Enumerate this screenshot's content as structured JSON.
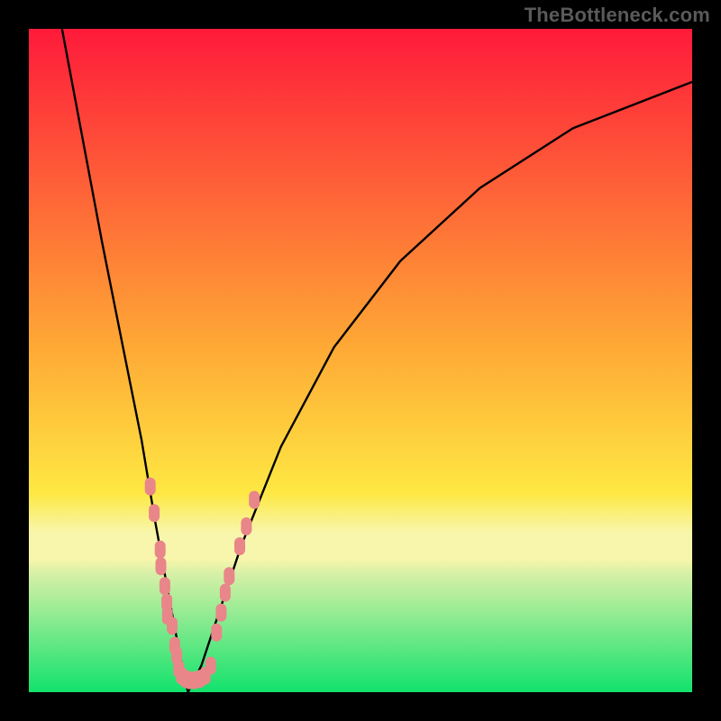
{
  "watermark": "TheBottleneck.com",
  "colors": {
    "frame": "#000000",
    "curve": "#000000",
    "scatter": "#e98689",
    "gradient_top": "#fe1a3a",
    "gradient_mid": "#fee843",
    "gradient_band_top": "#f7f6ac",
    "gradient_band_bot": "#d8f0a7",
    "gradient_bottom": "#12e26c"
  },
  "chart_data": {
    "type": "line",
    "title": "",
    "xlabel": "",
    "ylabel": "",
    "xlim": [
      0,
      100
    ],
    "ylim": [
      0,
      100
    ],
    "notch_x": 24,
    "left_curve": {
      "x": [
        5,
        8,
        11,
        14,
        17,
        19,
        21,
        22.5,
        23.5,
        24
      ],
      "values": [
        100,
        84,
        68,
        53,
        38,
        26,
        15,
        7,
        2,
        0
      ]
    },
    "right_curve": {
      "x": [
        24,
        26,
        28,
        32,
        38,
        46,
        56,
        68,
        82,
        100
      ],
      "values": [
        0,
        4,
        10,
        22,
        37,
        52,
        65,
        76,
        85,
        92
      ]
    },
    "scatter_points": [
      {
        "x": 18.3,
        "y": 31
      },
      {
        "x": 18.9,
        "y": 27
      },
      {
        "x": 19.8,
        "y": 21.5
      },
      {
        "x": 19.9,
        "y": 19
      },
      {
        "x": 20.5,
        "y": 16
      },
      {
        "x": 20.8,
        "y": 13.5
      },
      {
        "x": 20.9,
        "y": 11.5
      },
      {
        "x": 21.6,
        "y": 10
      },
      {
        "x": 22.0,
        "y": 7
      },
      {
        "x": 22.3,
        "y": 5.5
      },
      {
        "x": 22.6,
        "y": 3.5
      },
      {
        "x": 23.0,
        "y": 2.5
      },
      {
        "x": 23.6,
        "y": 2
      },
      {
        "x": 24.2,
        "y": 1.8
      },
      {
        "x": 25.0,
        "y": 1.8
      },
      {
        "x": 25.8,
        "y": 2
      },
      {
        "x": 26.6,
        "y": 2.5
      },
      {
        "x": 27.4,
        "y": 4
      },
      {
        "x": 28.3,
        "y": 9
      },
      {
        "x": 29.0,
        "y": 12
      },
      {
        "x": 29.6,
        "y": 15
      },
      {
        "x": 30.2,
        "y": 17.5
      },
      {
        "x": 31.8,
        "y": 22
      },
      {
        "x": 32.8,
        "y": 25
      },
      {
        "x": 34.0,
        "y": 29
      }
    ],
    "band": {
      "y0": 23,
      "y1": 30,
      "top_color_ref": "gradient_band_top",
      "bot_color_ref": "gradient_band_bot"
    }
  }
}
